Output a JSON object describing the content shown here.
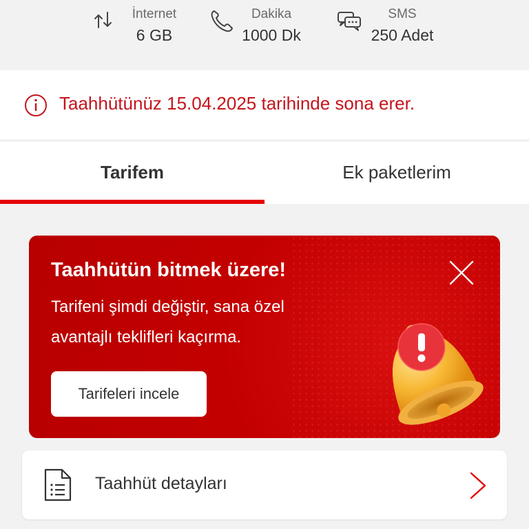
{
  "usage": {
    "internet": {
      "label": "İnternet",
      "value": "6 GB",
      "icon": "data-arrows-icon"
    },
    "minutes": {
      "label": "Dakika",
      "value": "1000 Dk",
      "icon": "phone-icon"
    },
    "sms": {
      "label": "SMS",
      "value": "250 Adet",
      "icon": "chat-bubbles-icon"
    }
  },
  "notice": {
    "icon": "info-icon",
    "text": "Taahhütünüz 15.04.2025 tarihinde sona erer."
  },
  "tabs": [
    {
      "label": "Tarifem",
      "active": true
    },
    {
      "label": "Ek paketlerim",
      "active": false
    }
  ],
  "promo": {
    "title": "Taahhütün bitmek üzere!",
    "line1": "Tarifeni şimdi değiştir, sana özel",
    "line2": "avantajlı teklifleri kaçırma.",
    "button_label": "Tarifeleri incele",
    "close_icon": "close-icon",
    "illustration": "alert-bell-icon"
  },
  "detail_row": {
    "label": "Taahhüt detayları",
    "icon": "document-icon",
    "chevron": "chevron-right-icon"
  },
  "colors": {
    "brand_red": "#e60000",
    "notice_red": "#c4151c",
    "promo_red": "#c30000"
  }
}
